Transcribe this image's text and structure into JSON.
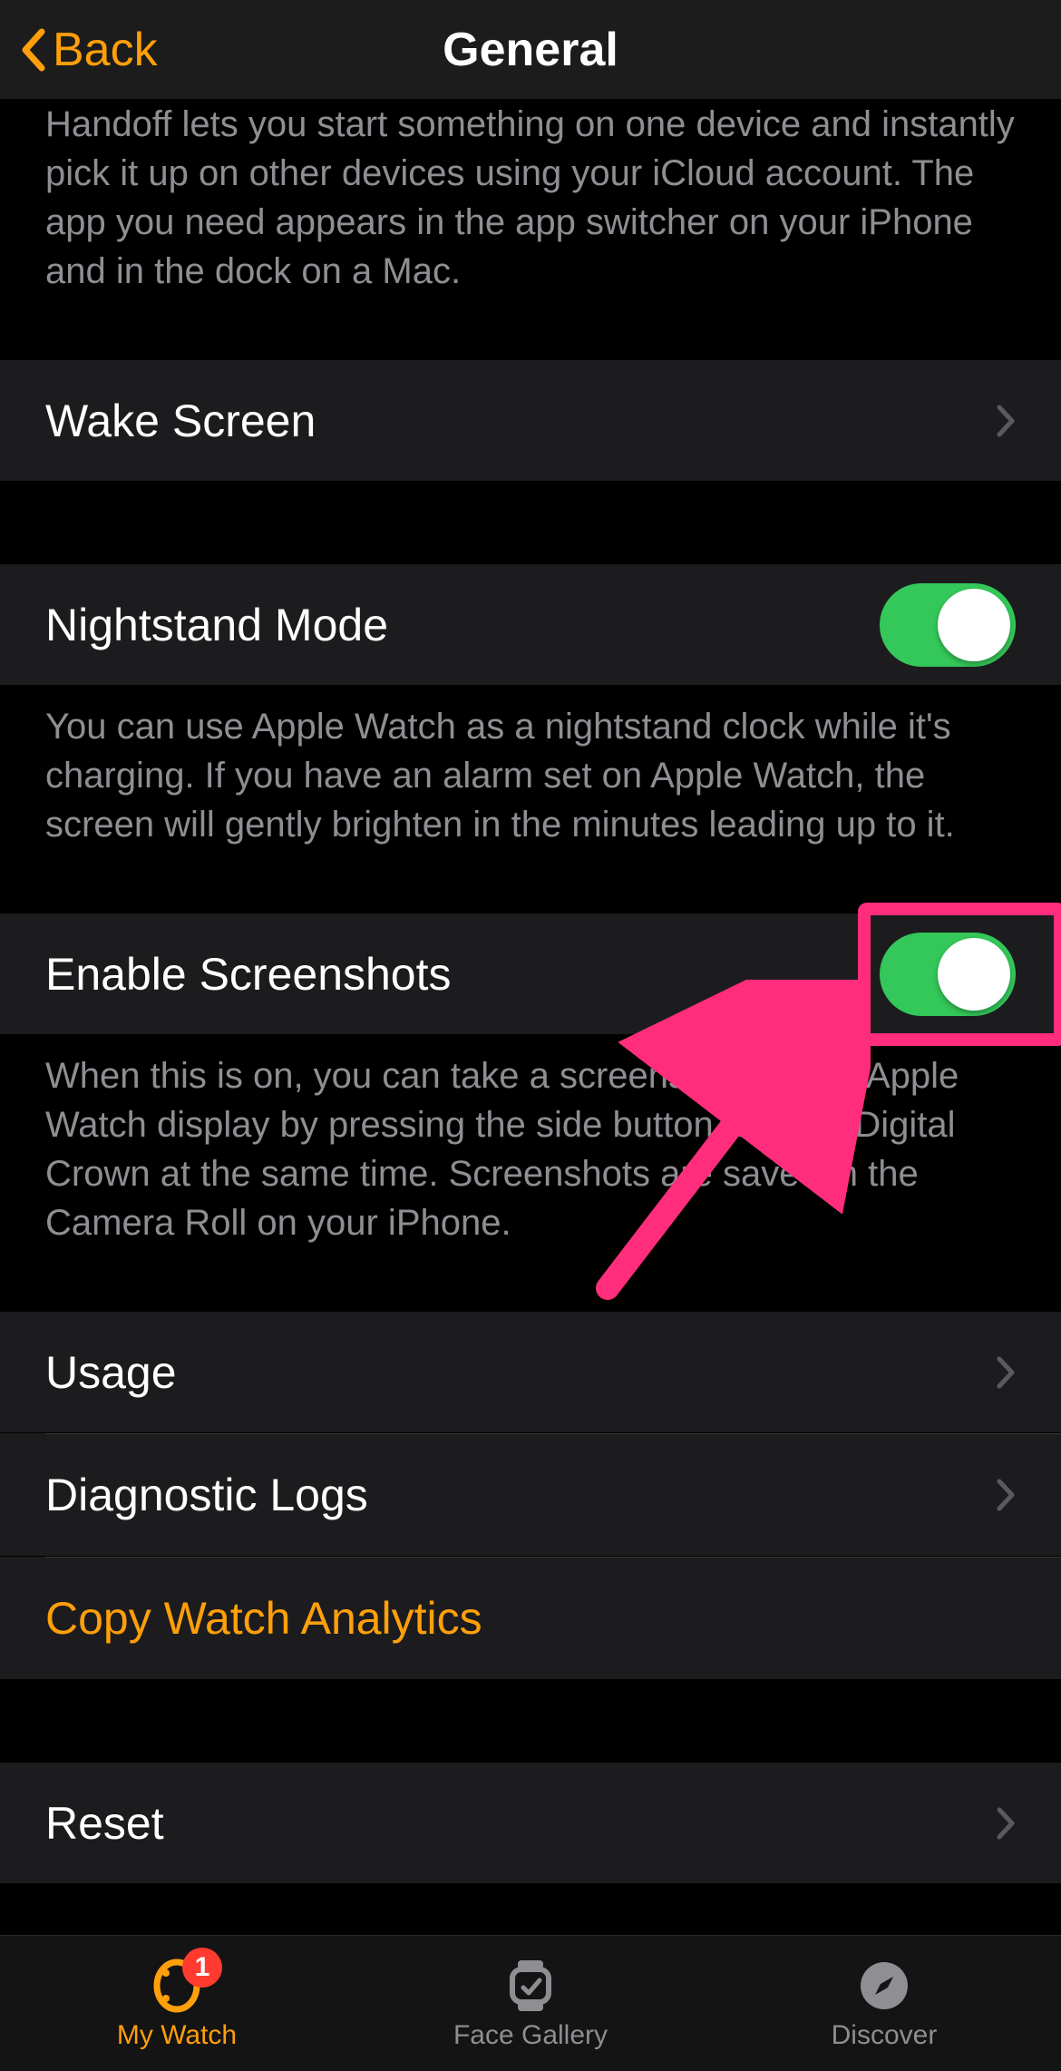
{
  "header": {
    "back_label": "Back",
    "title": "General"
  },
  "handoff_footer": "Handoff lets you start something on one device and instantly pick it up on other devices using your iCloud account. The app you need appears in the app switcher on your iPhone and in the dock on a Mac.",
  "wake_screen_label": "Wake Screen",
  "nightstand": {
    "label": "Nightstand Mode",
    "footer": "You can use Apple Watch as a nightstand clock while it's charging. If you have an alarm set on Apple Watch, the screen will gently brighten in the minutes leading up to it."
  },
  "screenshots": {
    "label": "Enable Screenshots",
    "footer": "When this is on, you can take a screenshot of your Apple Watch display by pressing the side button and the Digital Crown at the same time. Screenshots are saved in the Camera Roll on your iPhone."
  },
  "usage_label": "Usage",
  "diagnostic_label": "Diagnostic Logs",
  "analytics_label": "Copy Watch Analytics",
  "reset_label": "Reset",
  "tabs": {
    "my_watch": "My Watch",
    "face_gallery": "Face Gallery",
    "discover": "Discover",
    "badge": "1"
  }
}
